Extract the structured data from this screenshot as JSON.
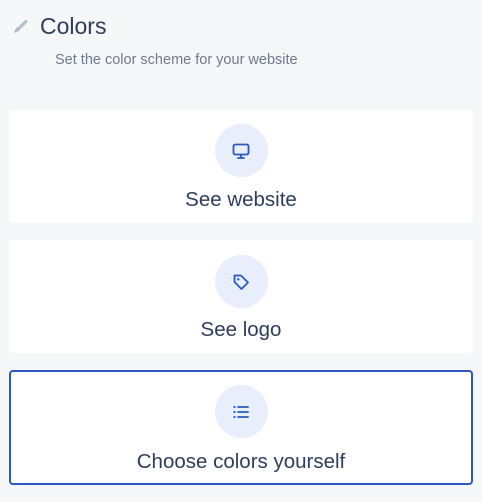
{
  "header": {
    "icon": "brush-icon",
    "title": "Colors",
    "subtitle": "Set the color scheme for your website"
  },
  "options": [
    {
      "label": "See website",
      "icon": "monitor-icon",
      "selected": false
    },
    {
      "label": "See logo",
      "icon": "tag-icon",
      "selected": false
    },
    {
      "label": "Choose colors yourself",
      "icon": "list-icon",
      "selected": true
    }
  ],
  "colors": {
    "accent": "#2b58c2",
    "icon_bg": "#e8eefb",
    "text": "#2d3e5c",
    "muted_text": "#6d7a8f",
    "page_bg": "#f6f7f9"
  }
}
